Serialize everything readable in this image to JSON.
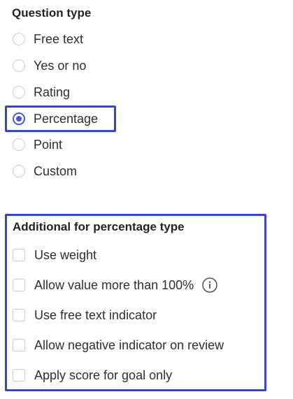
{
  "question_type": {
    "title": "Question type",
    "options": [
      {
        "label": "Free text",
        "selected": false
      },
      {
        "label": "Yes or no",
        "selected": false
      },
      {
        "label": "Rating",
        "selected": false
      },
      {
        "label": "Percentage",
        "selected": true
      },
      {
        "label": "Point",
        "selected": false
      },
      {
        "label": "Custom",
        "selected": false
      }
    ]
  },
  "additional": {
    "title": "Additional for percentage type",
    "options": [
      {
        "label": "Use weight",
        "checked": false
      },
      {
        "label": "Allow value more than 100%",
        "checked": false,
        "icon": "info-icon"
      },
      {
        "label": "Use free text indicator",
        "checked": false
      },
      {
        "label": "Allow negative indicator on review",
        "checked": false
      },
      {
        "label": "Apply score for goal only",
        "checked": false
      }
    ]
  },
  "colors": {
    "accent": "#4a57d6",
    "highlight_border": "#3a43c9",
    "control_border": "#c9ccd2",
    "text": "#2b2f36"
  }
}
